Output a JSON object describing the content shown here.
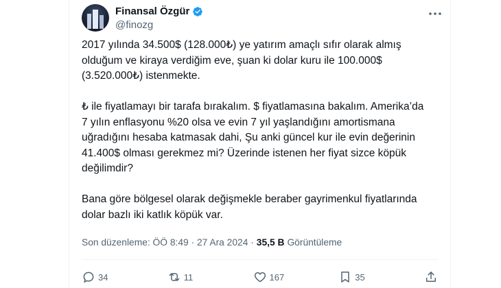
{
  "author": {
    "name": "Finansal Özgür",
    "handle": "@finozg"
  },
  "post": {
    "text": "2017 yılında 34.500$ (128.000₺) ye yatırım amaçlı sıfır olarak almış\nolduğum ve kiraya verdiğim eve, şuan ki dolar kuru ile 100.000$\n(3.520.000₺) istenmekte.\n\n₺ ile fiyatlamayı bir tarafa bırakalım. $ fiyatlamasına bakalım. Amerika’da\n7 yılın enflasyonu %20 olsa ve evin 7 yıl yaşlandığını amortismana\nuğradığını hesaba katmasak dahi, Şu anki güncel kur ile evin değerinin\n41.400$ olması gerekmez mi? Üzerinde istenen her fiyat sizce köpük\ndeğilimdir?\n\nBana göre bölgesel olarak değişmekle beraber gayrimenkul fiyatlarında\ndolar bazlı iki katlık köpük var."
  },
  "meta": {
    "edited_time": "Son düzenleme: ÖÖ 8:49 · 27 Ara 2024 · ",
    "views_count": "35,5 B",
    "views_label": "Görüntüleme"
  },
  "actions": {
    "replies": "34",
    "reposts": "11",
    "likes": "167",
    "bookmarks": "35"
  },
  "colors": {
    "verified": "#1d9bf0",
    "secondary_text": "#536471"
  }
}
